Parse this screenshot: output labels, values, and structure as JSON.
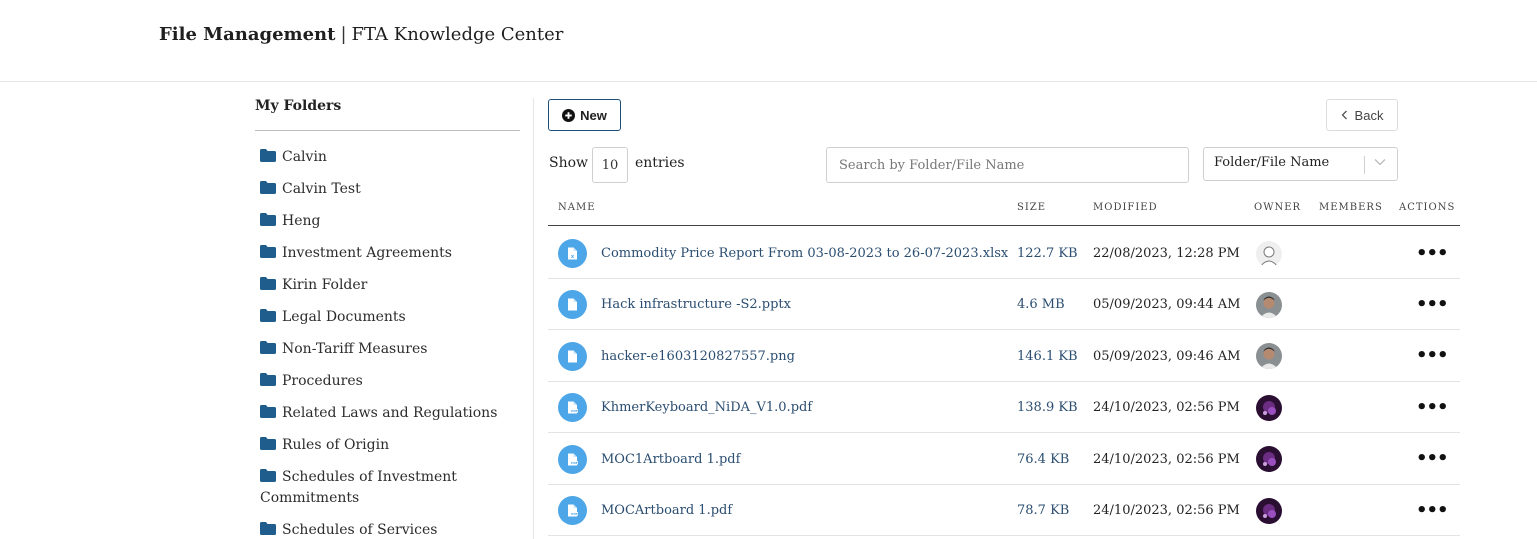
{
  "header": {
    "title_strong": "File Management",
    "separator": "|",
    "title_rest": "FTA Knowledge Center"
  },
  "sidebar": {
    "title": "My Folders",
    "folders": [
      "Calvin",
      "Calvin Test",
      "Heng",
      "Investment Agreements",
      "Kirin Folder",
      "Legal Documents",
      "Non-Tariff Measures",
      "Procedures",
      "Related Laws and Regulations",
      "Rules of Origin",
      "Schedules of Investment Commitments",
      "Schedules of Services"
    ]
  },
  "toolbar": {
    "new_label": "New",
    "back_label": "Back",
    "new_icon": "plus-circle-icon",
    "back_icon": "chevron-left-icon"
  },
  "controls": {
    "show_label": "Show",
    "entries_value": "10",
    "entries_label": "entries",
    "search_placeholder": "Search by Folder/File Name",
    "filter_selected": "Folder/File Name"
  },
  "table": {
    "columns": [
      "Name",
      "Size",
      "Modified",
      "Owner",
      "Members",
      "Actions"
    ],
    "rows": [
      {
        "name": "Commodity Price Report From 03-08-2023 to 26-07-2023.xlsx",
        "size": "122.7 KB",
        "modified": "22/08/2023, 12:28 PM",
        "icon": "excel-file-icon",
        "owner_avatar": "default-user-avatar",
        "actions": "•••"
      },
      {
        "name": "Hack infrastructure -S2.pptx",
        "size": "4.6 MB",
        "modified": "05/09/2023, 09:44 AM",
        "icon": "file-icon",
        "owner_avatar": "user-photo-avatar",
        "actions": "•••"
      },
      {
        "name": "hacker-e1603120827557.png",
        "size": "146.1 KB",
        "modified": "05/09/2023, 09:46 AM",
        "icon": "file-icon",
        "owner_avatar": "user-photo-avatar",
        "actions": "•••"
      },
      {
        "name": "KhmerKeyboard_NiDA_V1.0.pdf",
        "size": "138.9 KB",
        "modified": "24/10/2023, 02:56 PM",
        "icon": "pdf-file-icon",
        "owner_avatar": "purple-user-avatar",
        "actions": "•••"
      },
      {
        "name": "MOC1Artboard 1.pdf",
        "size": "76.4 KB",
        "modified": "24/10/2023, 02:56 PM",
        "icon": "pdf-file-icon",
        "owner_avatar": "purple-user-avatar",
        "actions": "•••"
      },
      {
        "name": "MOCArtboard 1.pdf",
        "size": "78.7 KB",
        "modified": "24/10/2023, 02:56 PM",
        "icon": "pdf-file-icon",
        "owner_avatar": "purple-user-avatar",
        "actions": "•••"
      }
    ]
  },
  "colors": {
    "accent": "#1c5a8a",
    "folder": "#1f5d8c",
    "file_icon_bg": "#4da6e8",
    "link_text": "#2a4d70"
  }
}
